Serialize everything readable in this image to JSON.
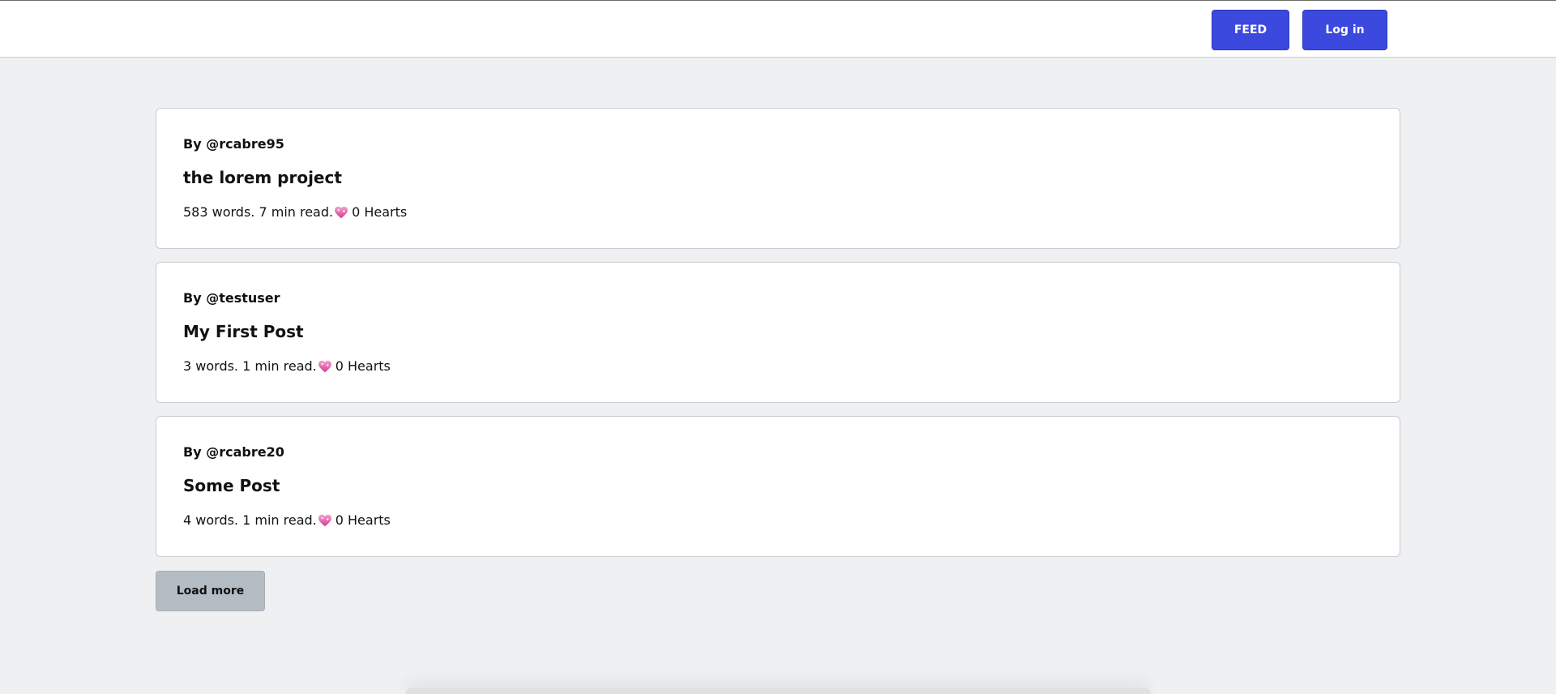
{
  "header": {
    "feed_label": "FEED",
    "login_label": "Log in"
  },
  "posts": [
    {
      "author": "By @rcabre95",
      "title": "the lorem project",
      "meta_prefix": "583 words. 7 min read.",
      "hearts": "0 Hearts"
    },
    {
      "author": "By @testuser",
      "title": "My First Post",
      "meta_prefix": "3 words. 1 min read.",
      "hearts": "0 Hearts"
    },
    {
      "author": "By @rcabre20",
      "title": "Some Post",
      "meta_prefix": "4 words. 1 min read.",
      "hearts": "0 Hearts"
    }
  ],
  "load_more_label": "Load more",
  "colors": {
    "primary": "#3b49df",
    "background": "#eef0f2",
    "load_more_bg": "#b4bcc4",
    "heart": "#e15ba5"
  },
  "icons": {
    "heart": "heart-icon"
  }
}
